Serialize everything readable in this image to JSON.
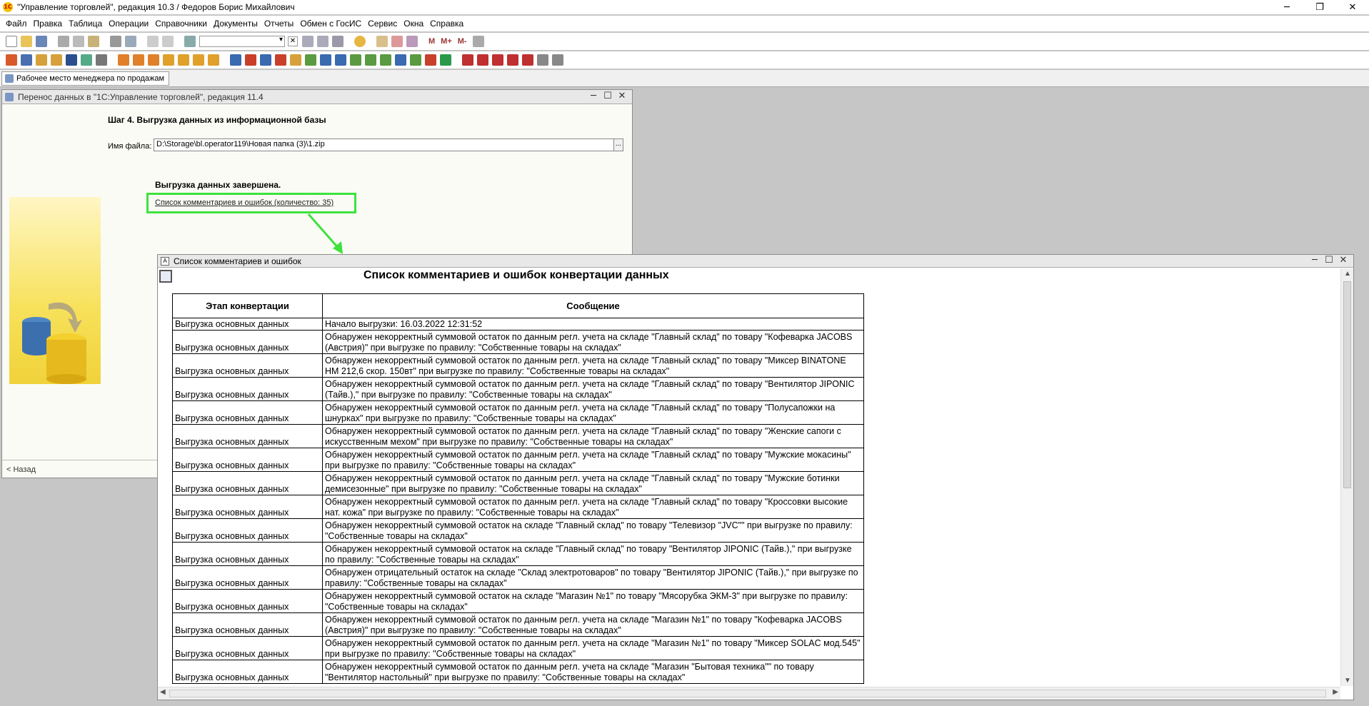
{
  "app": {
    "title": "\"Управление торговлей\", редакция 10.3 / Федоров Борис Михайлович",
    "icon_text": "1С"
  },
  "window_controls": {
    "minimize": "─",
    "restore": "❐",
    "close": "✕"
  },
  "menu": [
    "Файл",
    "Правка",
    "Таблица",
    "Операции",
    "Справочники",
    "Документы",
    "Отчеты",
    "Обмен с ГосИС",
    "Сервис",
    "Окна",
    "Справка"
  ],
  "toolbar": {
    "m": "M",
    "m_plus": "M+",
    "m_minus": "M-",
    "clear": "✕"
  },
  "open_window_tab": "Рабочее место менеджера по продажам",
  "transfer_window": {
    "title": "Перенос данных в \"1С:Управление торговлей\", редакция 11.4",
    "step_title": "Шаг 4. Выгрузка данных из информационной базы",
    "file_label": "Имя файла:",
    "file_value": "D:\\Storage\\bl.operator119\\Новая папка (3)\\1.zip",
    "browse": "...",
    "done_text": "Выгрузка данных завершена.",
    "errors_link": "Список комментариев и ошибок (количество: 35)",
    "back_button": "< Назад"
  },
  "error_window": {
    "title": "Список комментариев и ошибок",
    "doc_title": "Список комментариев и ошибок конвертации данных",
    "columns": [
      "Этап конвертации",
      "Сообщение"
    ],
    "rows": [
      {
        "stage": "Выгрузка основных данных",
        "message": "Начало выгрузки:   16.03.2022 12:31:52"
      },
      {
        "stage": "Выгрузка основных данных",
        "message": "Обнаружен некорректный суммовой остаток по данным регл. учета на складе \"Главный склад\" по товару \"Кофеварка JACOBS (Австрия)\" при выгрузке по правилу: \"Собственные товары на складах\""
      },
      {
        "stage": "Выгрузка основных данных",
        "message": "Обнаружен некорректный суммовой остаток по данным регл. учета на складе \"Главный склад\" по товару \"Миксер BINATONE HM 212,6 скор. 150вт\" при выгрузке по правилу: \"Собственные товары на складах\""
      },
      {
        "stage": "Выгрузка основных данных",
        "message": "Обнаружен некорректный суммовой остаток по данным регл. учета на складе \"Главный склад\" по товару \"Вентилятор JIPONIC (Тайв.),\" при выгрузке по правилу: \"Собственные товары на складах\""
      },
      {
        "stage": "Выгрузка основных данных",
        "message": "Обнаружен некорректный суммовой остаток по данным регл. учета на складе \"Главный склад\" по товару \"Полусапожки на шнурках\" при выгрузке по правилу: \"Собственные товары на складах\""
      },
      {
        "stage": "Выгрузка основных данных",
        "message": "Обнаружен некорректный суммовой остаток по данным регл. учета на складе \"Главный склад\" по товару \"Женские сапоги с искусственным мехом\" при выгрузке по правилу: \"Собственные товары на складах\""
      },
      {
        "stage": "Выгрузка основных данных",
        "message": "Обнаружен некорректный суммовой остаток по данным регл. учета на складе \"Главный склад\" по товару \"Мужские мокасины\" при выгрузке по правилу: \"Собственные товары на складах\""
      },
      {
        "stage": "Выгрузка основных данных",
        "message": "Обнаружен некорректный суммовой остаток по данным регл. учета на складе \"Главный склад\" по товару \"Мужские ботинки демисезонные\" при выгрузке по правилу: \"Собственные товары на складах\""
      },
      {
        "stage": "Выгрузка основных данных",
        "message": "Обнаружен некорректный суммовой остаток по данным регл. учета на складе \"Главный склад\" по товару \"Кроссовки высокие нат. кожа\" при выгрузке по правилу: \"Собственные товары на складах\""
      },
      {
        "stage": "Выгрузка основных данных",
        "message": "Обнаружен некорректный суммовой остаток на складе \"Главный склад\" по товару \"Телевизор \"JVC\"\" при выгрузке по правилу: \"Собственные товары на складах\""
      },
      {
        "stage": "Выгрузка основных данных",
        "message": "Обнаружен некорректный суммовой остаток на складе \"Главный склад\" по товару \"Вентилятор JIPONIC (Тайв.),\" при выгрузке по правилу: \"Собственные товары на складах\""
      },
      {
        "stage": "Выгрузка основных данных",
        "message": "Обнаружен отрицательный остаток на складе \"Склад электротоваров\" по товару \"Вентилятор JIPONIC (Тайв.),\" при выгрузке по правилу: \"Собственные товары на складах\""
      },
      {
        "stage": "Выгрузка основных данных",
        "message": "Обнаружен некорректный суммовой остаток на складе \"Магазин №1\" по товару \"Мясорубка ЭКМ-3\" при выгрузке по правилу: \"Собственные товары на складах\""
      },
      {
        "stage": "Выгрузка основных данных",
        "message": "Обнаружен некорректный суммовой остаток по данным регл. учета на складе \"Магазин №1\" по товару \"Кофеварка JACOBS (Австрия)\" при выгрузке по правилу: \"Собственные товары на складах\""
      },
      {
        "stage": "Выгрузка основных данных",
        "message": "Обнаружен некорректный суммовой остаток по данным регл. учета на складе \"Магазин №1\" по товару \"Миксер SOLAC мод.545\" при выгрузке по правилу: \"Собственные товары на складах\""
      },
      {
        "stage": "Выгрузка основных данных",
        "message": "Обнаружен некорректный суммовой остаток по данным регл. учета на складе \"Магазин \"Бытовая техника\"\" по товару \"Вентилятор настольный\" при выгрузке по правилу: \"Собственные товары на складах\""
      }
    ]
  },
  "colors": {
    "highlight": "#3de23d",
    "accent": "#c00000"
  }
}
